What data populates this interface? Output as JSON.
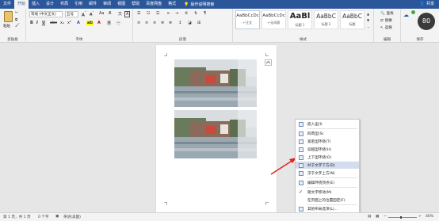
{
  "tabs": [
    "文件",
    "开始",
    "插入",
    "设计",
    "布局",
    "引用",
    "邮件",
    "审阅",
    "视图",
    "帮助",
    "百度网盘",
    "格式"
  ],
  "active_tab_index": 1,
  "search_label": "操作说明搜索",
  "share_label": "共享",
  "clipboard": {
    "paste": "粘贴",
    "group": "剪贴板"
  },
  "font": {
    "name": "等线 (中文正文)",
    "size": "五号",
    "group": "字体"
  },
  "paragraph": {
    "group": "段落"
  },
  "styles": {
    "group": "样式",
    "items": [
      {
        "sample": "AaBbCcDc",
        "name": "↵正文"
      },
      {
        "sample": "AaBbCcDc",
        "name": "↵无间隔"
      },
      {
        "sample": "AaBl",
        "name": "标题 1"
      },
      {
        "sample": "AaBbC",
        "name": "标题 2"
      },
      {
        "sample": "AaBbC",
        "name": "标题"
      }
    ]
  },
  "editing": {
    "find": "查找",
    "replace": "替换",
    "select": "选择",
    "group": "编辑"
  },
  "save": {
    "group": "保存"
  },
  "badge_value": "80",
  "context_menu": [
    {
      "label": "嵌入型(I)",
      "icon": "inline-icon"
    },
    {
      "label": "四周型(S)",
      "icon": "square-wrap-icon"
    },
    {
      "label": "紧密型环绕(T)",
      "icon": "tight-wrap-icon"
    },
    {
      "label": "穿越型环绕(H)",
      "icon": "through-wrap-icon"
    },
    {
      "label": "上下型环绕(O)",
      "icon": "top-bottom-icon"
    },
    {
      "label": "衬于文字下方(D)",
      "icon": "behind-text-icon"
    },
    {
      "label": "浮于文字上方(N)",
      "icon": "in-front-icon"
    },
    {
      "label": "编辑环绕顶点(E)",
      "icon": "edit-points-icon"
    },
    {
      "label": "随文字移动(M)",
      "icon": "check-icon"
    },
    {
      "label": "在页面上的位置固定(F)",
      "icon": ""
    },
    {
      "label": "其他布局选项(L)...",
      "icon": "layout-options-icon"
    },
    {
      "label": "设置为默认布局(A)",
      "icon": ""
    }
  ],
  "context_menu_highlight_index": 5,
  "status": {
    "page": "第 1 页，共 1 页",
    "words": "0 个字",
    "lang": "英语(美国)",
    "zoom": "46%"
  }
}
